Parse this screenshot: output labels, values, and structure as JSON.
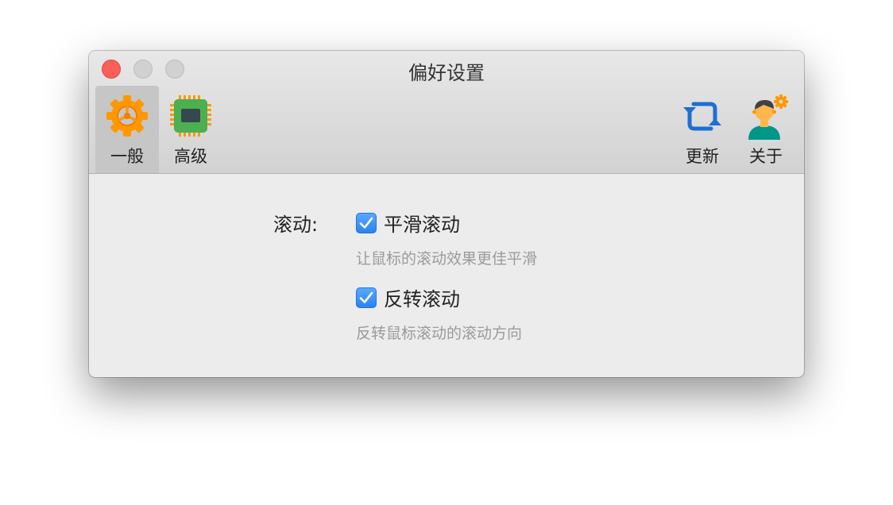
{
  "window": {
    "title": "偏好设置"
  },
  "toolbar": {
    "items": [
      {
        "label": "一般",
        "icon": "gear-icon",
        "selected": true
      },
      {
        "label": "高级",
        "icon": "chip-icon",
        "selected": false
      },
      {
        "label": "更新",
        "icon": "refresh-icon",
        "selected": false
      },
      {
        "label": "关于",
        "icon": "user-gear-icon",
        "selected": false
      }
    ]
  },
  "general": {
    "scroll_label": "滚动:",
    "options": [
      {
        "label": "平滑滚动",
        "checked": true,
        "hint": "让鼠标的滚动效果更佳平滑"
      },
      {
        "label": "反转滚动",
        "checked": true,
        "hint": "反转鼠标滚动的滚动方向"
      }
    ]
  },
  "colors": {
    "accent": "#3b8ef6",
    "close": "#fc5f57",
    "gear": "#ff9800",
    "chip": "#4caf50",
    "refresh": "#1e6fd0"
  }
}
